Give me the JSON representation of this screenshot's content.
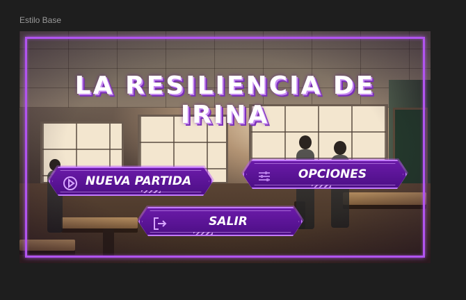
{
  "frame": {
    "label": "Estilo Base"
  },
  "menu": {
    "title_line1": "LA RESILIENCIA DE",
    "title_line2": "IRINA",
    "buttons": {
      "new_game": "NUEVA PARTIDA",
      "options": "OPCIONES",
      "exit": "SALIR"
    },
    "icons": {
      "new_game": "play-circle-icon",
      "options": "sliders-icon",
      "exit": "exit-door-icon"
    }
  },
  "theme": {
    "accent": "#b154f0",
    "button_fill": "#5a1496",
    "canvas_bg": "#1e1e1e"
  }
}
